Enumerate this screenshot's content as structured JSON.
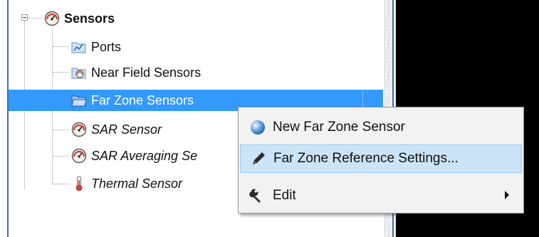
{
  "tree": {
    "root": {
      "label": "Sensors",
      "icon": "gauge-icon"
    },
    "children": [
      {
        "label": "Ports",
        "icon": "folder-chart-icon",
        "italic": false
      },
      {
        "label": "Near Field Sensors",
        "icon": "folder-gauge-icon",
        "italic": false
      },
      {
        "label": "Far Zone Sensors",
        "icon": "folder-open-icon",
        "italic": false,
        "selected": true
      },
      {
        "label": "SAR Sensor",
        "icon": "gauge-icon",
        "italic": true
      },
      {
        "label": "SAR Averaging Se",
        "icon": "gauge-icon",
        "italic": true
      },
      {
        "label": "Thermal Sensor",
        "icon": "thermometer-icon",
        "italic": true
      }
    ]
  },
  "context_menu": {
    "items": [
      {
        "label": "New Far Zone Sensor",
        "icon": "globe-sphere-icon",
        "hovered": false
      },
      {
        "label": "Far Zone Reference Settings...",
        "icon": "pencil-icon",
        "hovered": true
      },
      {
        "label": "Edit",
        "icon": "wrench-icon",
        "hovered": false,
        "submenu": true
      }
    ]
  },
  "colors": {
    "selection": "#3399ff",
    "menu_hover": "#cce4f7",
    "menu_background": "#f2f2f2",
    "right_panel": "#000000"
  }
}
